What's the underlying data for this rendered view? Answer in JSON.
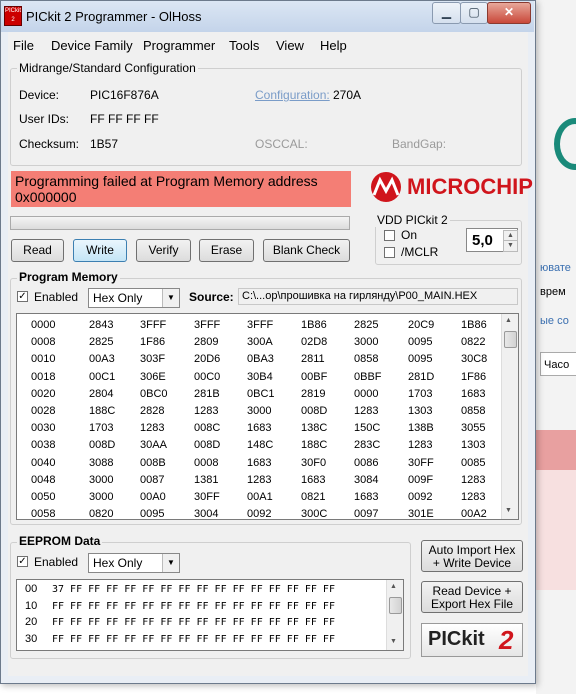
{
  "window": {
    "title": "PICkit 2 Programmer - OlHoss",
    "icon_text": "PICkit 2"
  },
  "menu": [
    "File",
    "Device Family",
    "Programmer",
    "Tools",
    "View",
    "Help"
  ],
  "config": {
    "group_label": "Midrange/Standard Configuration",
    "device_label": "Device:",
    "device_value": "PIC16F876A",
    "configuration_label": "Configuration:",
    "configuration_value": "270A",
    "userids_label": "User IDs:",
    "userids_value": "FF FF FF FF",
    "checksum_label": "Checksum:",
    "checksum_value": "1B57",
    "osccal_label": "OSCCAL:",
    "bandgap_label": "BandGap:"
  },
  "status": {
    "message": "Programming failed at Program Memory address 0x000000",
    "color": "#f47e75",
    "progress": 0
  },
  "logo": {
    "text": "MICROCHIP",
    "color": "#d0151c"
  },
  "vdd": {
    "group_label": "VDD PICkit 2",
    "on_label": "On",
    "mclr_label": "/MCLR",
    "voltage": "5,0",
    "on_checked": false,
    "mclr_checked": false
  },
  "buttons": {
    "read": "Read",
    "write": "Write",
    "verify": "Verify",
    "erase": "Erase",
    "blank_check": "Blank Check"
  },
  "program_memory": {
    "group_label": "Program Memory",
    "enabled_label": "Enabled",
    "enabled": true,
    "format": "Hex Only",
    "source_label": "Source:",
    "source_path": "C:\\...ор\\прошивка на гирлянду\\P00_MAIN.HEX",
    "rows": [
      {
        "addr": "0000",
        "words": [
          "2843",
          "3FFF",
          "3FFF",
          "3FFF",
          "1B86",
          "2825",
          "20C9",
          "1B86"
        ]
      },
      {
        "addr": "0008",
        "words": [
          "2825",
          "1F86",
          "2809",
          "300A",
          "02D8",
          "3000",
          "0095",
          "0822"
        ]
      },
      {
        "addr": "0010",
        "words": [
          "00A3",
          "303F",
          "20D6",
          "0BA3",
          "2811",
          "0858",
          "0095",
          "30C8"
        ]
      },
      {
        "addr": "0018",
        "words": [
          "00C1",
          "306E",
          "00C0",
          "30B4",
          "00BF",
          "0BBF",
          "281D",
          "1F86"
        ]
      },
      {
        "addr": "0020",
        "words": [
          "2804",
          "0BC0",
          "281B",
          "0BC1",
          "2819",
          "0000",
          "1703",
          "1683"
        ]
      },
      {
        "addr": "0028",
        "words": [
          "188C",
          "2828",
          "1283",
          "3000",
          "008D",
          "1283",
          "1303",
          "0858"
        ]
      },
      {
        "addr": "0030",
        "words": [
          "1703",
          "1283",
          "008C",
          "1683",
          "138C",
          "150C",
          "138B",
          "3055"
        ]
      },
      {
        "addr": "0038",
        "words": [
          "008D",
          "30AA",
          "008D",
          "148C",
          "188C",
          "283C",
          "1283",
          "1303"
        ]
      },
      {
        "addr": "0040",
        "words": [
          "3088",
          "008B",
          "0008",
          "1683",
          "30F0",
          "0086",
          "30FF",
          "0085"
        ]
      },
      {
        "addr": "0048",
        "words": [
          "3000",
          "0087",
          "1381",
          "1283",
          "1683",
          "3084",
          "009F",
          "1283"
        ]
      },
      {
        "addr": "0050",
        "words": [
          "3000",
          "00A0",
          "30FF",
          "00A1",
          "0821",
          "1683",
          "0092",
          "1283"
        ]
      },
      {
        "addr": "0058",
        "words": [
          "0820",
          "0095",
          "3004",
          "0092",
          "300C",
          "0097",
          "301E",
          "00A2"
        ]
      }
    ]
  },
  "eeprom": {
    "group_label": "EEPROM Data",
    "enabled_label": "Enabled",
    "enabled": true,
    "format": "Hex Only",
    "rows": [
      {
        "addr": "00",
        "bytes": "37 FF FF FF FF FF FF FF FF FF FF FF FF FF FF FF"
      },
      {
        "addr": "10",
        "bytes": "FF FF FF FF FF FF FF FF FF FF FF FF FF FF FF FF"
      },
      {
        "addr": "20",
        "bytes": "FF FF FF FF FF FF FF FF FF FF FF FF FF FF FF FF"
      },
      {
        "addr": "30",
        "bytes": "FF FF FF FF FF FF FF FF FF FF FF FF FF FF FF FF"
      }
    ]
  },
  "side_buttons": {
    "auto_import": [
      "Auto Import Hex",
      "+ Write Device"
    ],
    "read_export": [
      "Read Device +",
      "Export Hex File"
    ]
  },
  "brand": {
    "text": "PICkit",
    "number": "2"
  },
  "background_app": {
    "texts": [
      "ювате",
      "врем",
      "ые со"
    ],
    "combo": "Часо"
  }
}
